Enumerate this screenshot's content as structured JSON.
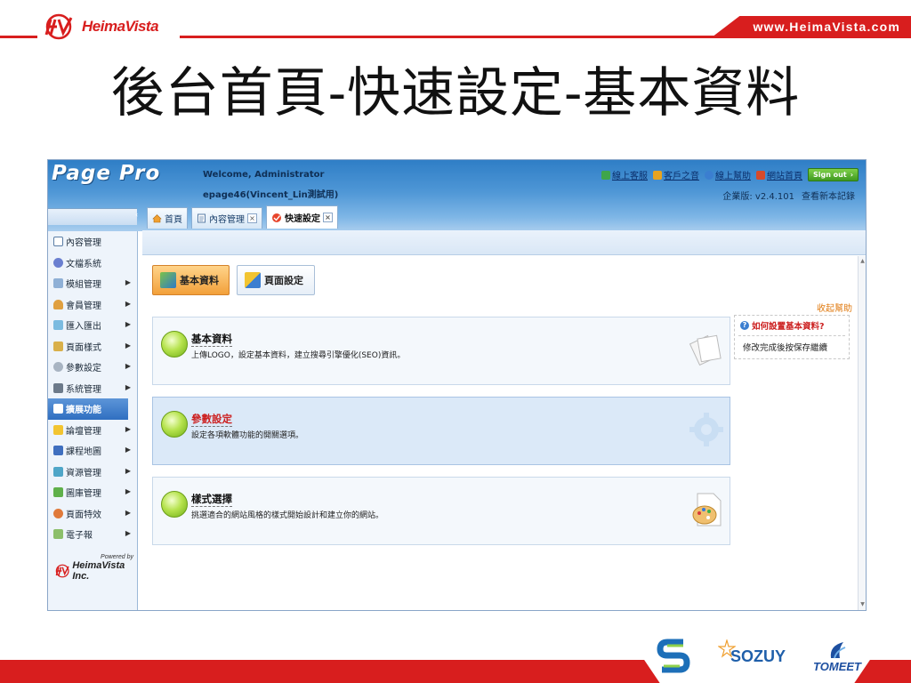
{
  "slide": {
    "brand_logo_text": "HeimaVista",
    "url": "www.HeimaVista.com",
    "title": "後台首頁-快速設定-基本資料",
    "partners": [
      "SOZUY",
      "TOMEET"
    ]
  },
  "app": {
    "brand": "Page Pro",
    "welcome": "Welcome, Administrator",
    "account": "epage46(Vincent_Lin測試用)",
    "top_links": [
      {
        "label": "線上客服",
        "icon": "phone-icon"
      },
      {
        "label": "客戶之音",
        "icon": "voice-icon"
      },
      {
        "label": "線上幫助",
        "icon": "help-icon"
      },
      {
        "label": "網站首頁",
        "icon": "home-site-icon"
      }
    ],
    "signout_label": "Sign out",
    "version": "企業版: v2.4.101",
    "view_changelog": "查看新本記錄",
    "tabs": [
      {
        "label": "首頁",
        "icon": "home-icon",
        "closable": false,
        "active": false
      },
      {
        "label": "內容管理",
        "icon": "document-icon",
        "closable": true,
        "active": false
      },
      {
        "label": "快速設定",
        "icon": "quick-setup-icon",
        "closable": true,
        "active": true
      }
    ],
    "tab_close_glyph": "×",
    "sidebar": [
      {
        "label": "內容管理",
        "icon": "content-icon",
        "submenu": false,
        "active": false
      },
      {
        "label": "文檔系統",
        "icon": "docs-icon",
        "submenu": false,
        "active": false
      },
      {
        "label": "模組管理",
        "icon": "module-icon",
        "submenu": true,
        "active": false
      },
      {
        "label": "會員管理",
        "icon": "members-icon",
        "submenu": true,
        "active": false
      },
      {
        "label": "匯入匯出",
        "icon": "import-export-icon",
        "submenu": true,
        "active": false
      },
      {
        "label": "頁面樣式",
        "icon": "page-style-icon",
        "submenu": true,
        "active": false
      },
      {
        "label": "參數設定",
        "icon": "settings-icon",
        "submenu": true,
        "active": false
      },
      {
        "label": "系統管理",
        "icon": "system-icon",
        "submenu": true,
        "active": false
      },
      {
        "label": "擴展功能",
        "icon": "extension-icon",
        "submenu": false,
        "active": true
      },
      {
        "label": "論壇管理",
        "icon": "forum-icon",
        "submenu": true,
        "active": false
      },
      {
        "label": "課程地圖",
        "icon": "course-map-icon",
        "submenu": true,
        "active": false
      },
      {
        "label": "資源管理",
        "icon": "resource-icon",
        "submenu": true,
        "active": false
      },
      {
        "label": "圖庫管理",
        "icon": "gallery-icon",
        "submenu": true,
        "active": false
      },
      {
        "label": "頁面特效",
        "icon": "effects-icon",
        "submenu": true,
        "active": false
      },
      {
        "label": "電子報",
        "icon": "newsletter-icon",
        "submenu": true,
        "active": false
      }
    ],
    "powered_by": "Powered by",
    "powered_name": "HeimaVista Inc.",
    "main": {
      "buttons": [
        {
          "label": "基本資料",
          "icon": "basic-info-icon"
        },
        {
          "label": "頁面設定",
          "icon": "page-setting-icon"
        }
      ],
      "collapse_help": "收起幫助",
      "cards": [
        {
          "title": "基本資料",
          "desc": "上傳LOGO，設定基本資料，建立搜尋引擎優化(SEO)資訊。",
          "art": "documents-icon",
          "highlight": false
        },
        {
          "title": "參數設定",
          "desc": "設定各項軟體功能的開關選項。",
          "art": "gear-icon",
          "highlight": true
        },
        {
          "title": "樣式選擇",
          "desc": "挑選適合的網站風格的樣式開始設計和建立你的網站。",
          "art": "palette-icon",
          "highlight": false
        }
      ],
      "help": {
        "question": "如何設置基本資料?",
        "answer": "修改完成後按保存繼續"
      }
    },
    "colors": {
      "accent_red": "#d81e1e",
      "header_blue": "#2f7ec6",
      "button_orange": "#f2a03a",
      "link_orange": "#e07a10"
    }
  }
}
